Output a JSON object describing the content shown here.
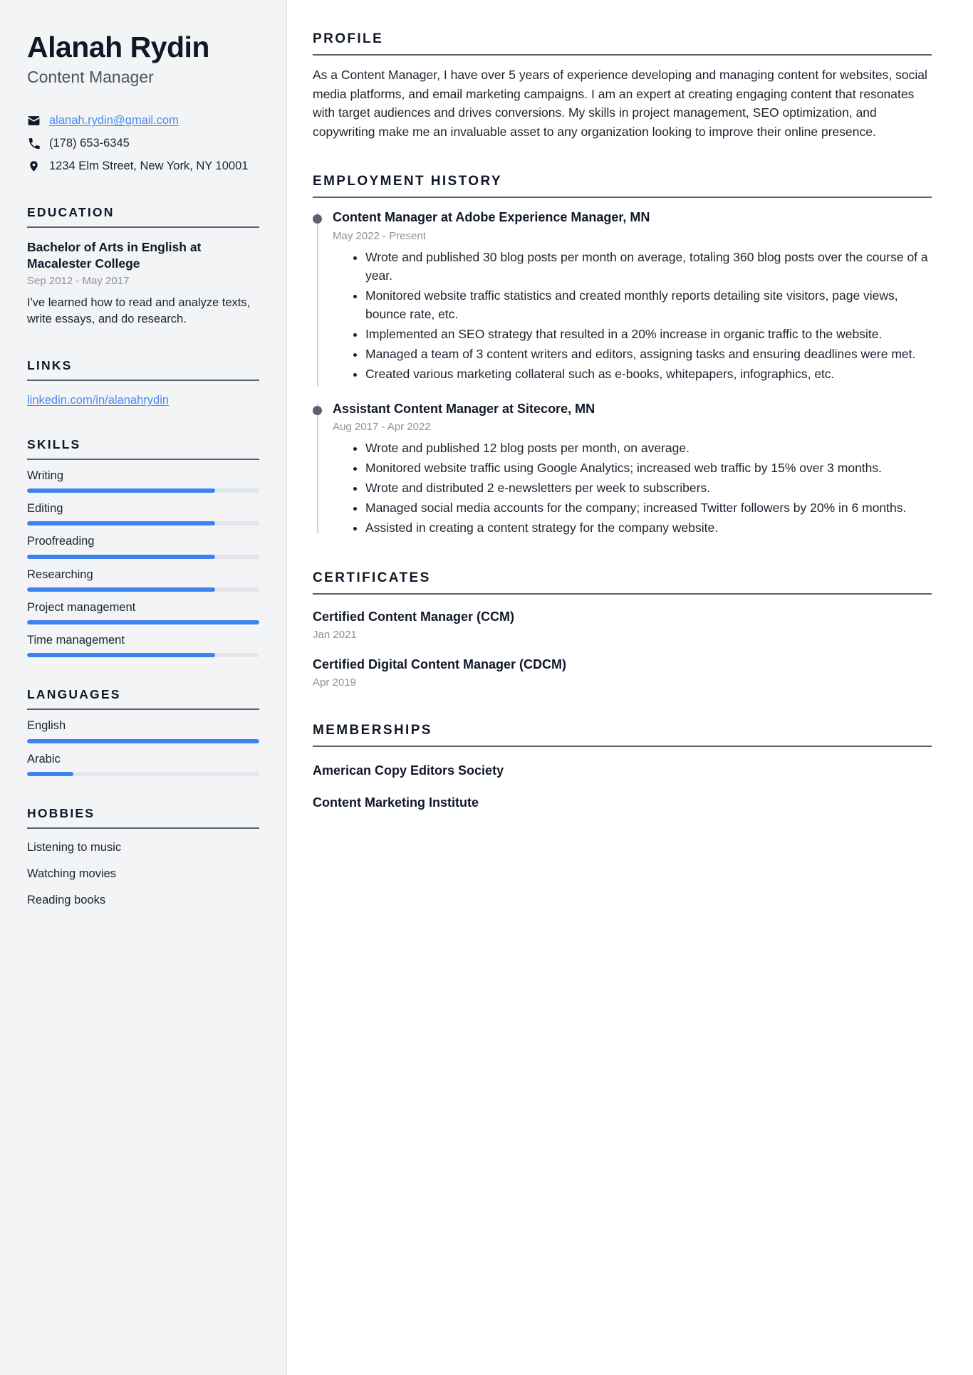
{
  "theme": {
    "accent": "#3d82ef",
    "link": "#4a8bf0",
    "heading": "#101827",
    "muted": "#8b919b",
    "sidebar_bg": "#f2f4f6",
    "rule": "#5a6270"
  },
  "header": {
    "name": "Alanah Rydin",
    "job_title": "Content Manager"
  },
  "contact": [
    {
      "icon": "envelope-icon",
      "text": "alanah.rydin@gmail.com",
      "is_link": true
    },
    {
      "icon": "phone-icon",
      "text": "(178) 653-6345",
      "is_link": false
    },
    {
      "icon": "location-pin-icon",
      "text": "1234 Elm Street, New York, NY 10001",
      "is_link": false
    }
  ],
  "education": {
    "heading": "EDUCATION",
    "items": [
      {
        "degree": "Bachelor of Arts in English at Macalester College",
        "dates": "Sep 2012 - May 2017",
        "description": "I've learned how to read and analyze texts, write essays, and do research."
      }
    ]
  },
  "links": {
    "heading": "LINKS",
    "items": [
      {
        "label": "linkedin.com/in/alanahrydin"
      }
    ]
  },
  "skills": {
    "heading": "SKILLS",
    "items": [
      {
        "label": "Writing",
        "level": 81
      },
      {
        "label": "Editing",
        "level": 81
      },
      {
        "label": "Proofreading",
        "level": 81
      },
      {
        "label": "Researching",
        "level": 81
      },
      {
        "label": "Project management",
        "level": 100
      },
      {
        "label": "Time management",
        "level": 81
      }
    ]
  },
  "languages": {
    "heading": "LANGUAGES",
    "items": [
      {
        "label": "English",
        "level": 100
      },
      {
        "label": "Arabic",
        "level": 20
      }
    ]
  },
  "hobbies": {
    "heading": "HOBBIES",
    "items": [
      {
        "label": "Listening to music"
      },
      {
        "label": "Watching movies"
      },
      {
        "label": "Reading books"
      }
    ]
  },
  "profile": {
    "heading": "PROFILE",
    "text": "As a Content Manager, I have over 5 years of experience developing and managing content for websites, social media platforms, and email marketing campaigns. I am an expert at creating engaging content that resonates with target audiences and drives conversions. My skills in project management, SEO optimization, and copywriting make me an invaluable asset to any organization looking to improve their online presence."
  },
  "employment": {
    "heading": "EMPLOYMENT HISTORY",
    "jobs": [
      {
        "role": "Content Manager at Adobe Experience Manager, MN",
        "dates": "May 2022 - Present",
        "bullets": [
          "Wrote and published 30 blog posts per month on average, totaling 360 blog posts over the course of a year.",
          "Monitored website traffic statistics and created monthly reports detailing site visitors, page views, bounce rate, etc.",
          "Implemented an SEO strategy that resulted in a 20% increase in organic traffic to the website.",
          "Managed a team of 3 content writers and editors, assigning tasks and ensuring deadlines were met.",
          "Created various marketing collateral such as e-books, whitepapers, infographics, etc."
        ]
      },
      {
        "role": "Assistant Content Manager at Sitecore, MN",
        "dates": "Aug 2017 - Apr 2022",
        "bullets": [
          "Wrote and published 12 blog posts per month, on average.",
          "Monitored website traffic using Google Analytics; increased web traffic by 15% over 3 months.",
          "Wrote and distributed 2 e-newsletters per week to subscribers.",
          "Managed social media accounts for the company; increased Twitter followers by 20% in 6 months.",
          "Assisted in creating a content strategy for the company website."
        ]
      }
    ]
  },
  "certificates": {
    "heading": "CERTIFICATES",
    "items": [
      {
        "name": "Certified Content Manager (CCM)",
        "date": "Jan 2021"
      },
      {
        "name": "Certified Digital Content Manager (CDCM)",
        "date": "Apr 2019"
      }
    ]
  },
  "memberships": {
    "heading": "MEMBERSHIPS",
    "items": [
      {
        "name": "American Copy Editors Society"
      },
      {
        "name": "Content Marketing Institute"
      }
    ]
  }
}
